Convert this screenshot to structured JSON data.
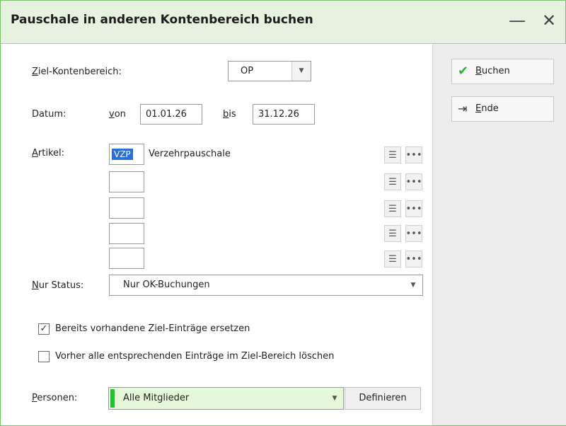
{
  "window": {
    "title": "Pauschale in anderen Kontenbereich buchen",
    "minimize_icon": "—",
    "close_icon": "✕"
  },
  "form": {
    "ziel_label_u": "Z",
    "ziel_label_rest": "iel-Kontenbereich:",
    "ziel_value": "OP",
    "datum_label": "Datum:",
    "von_u": "v",
    "von_rest": "on",
    "von_value": "01.01.26",
    "bis_u": "b",
    "bis_rest": "is",
    "bis_value": "31.12.26",
    "artikel_u": "A",
    "artikel_rest": "rtikel:",
    "artikel": [
      {
        "code": "VZP",
        "name": "Verzehrpauschale"
      },
      {
        "code": "",
        "name": ""
      },
      {
        "code": "",
        "name": ""
      },
      {
        "code": "",
        "name": ""
      },
      {
        "code": "",
        "name": ""
      }
    ],
    "status_u": "N",
    "status_rest": "ur Status:",
    "status_value": "Nur OK-Buchungen",
    "checkbox1_label": "Bereits vorhandene Ziel-Einträge ersetzen",
    "checkbox1_checked": true,
    "checkbox2_label": "Vorher alle entsprechenden Einträge im Ziel-Bereich löschen",
    "checkbox2_checked": false,
    "personen_u": "P",
    "personen_rest": "ersonen:",
    "personen_value": "Alle Mitglieder",
    "definieren_label": "Definieren"
  },
  "buttons": {
    "buchen_u": "B",
    "buchen_rest": "uchen",
    "ende_u": "E",
    "ende_rest": "nde"
  },
  "colors": {
    "accent_green": "#22c22a",
    "title_bg": "#e6f2df",
    "selection_blue": "#2a6fd3"
  }
}
